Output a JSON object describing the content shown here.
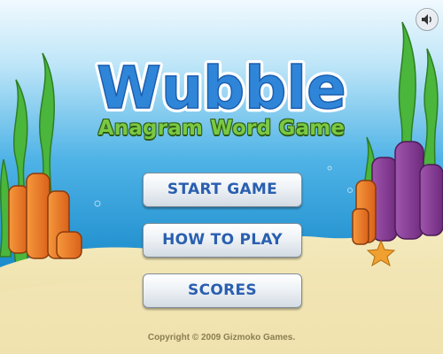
{
  "game": {
    "title": "Wubble",
    "subtitle": "Anagram Word Game",
    "copyright": "Copyright © 2009 Gizmoko Games."
  },
  "menu": {
    "items": [
      {
        "label": "START GAME",
        "name": "start-game-button"
      },
      {
        "label": "HOW TO PLAY",
        "name": "how-to-play-button"
      },
      {
        "label": "SCORES",
        "name": "scores-button"
      }
    ]
  },
  "controls": {
    "sound_icon": "speaker-icon"
  },
  "colors": {
    "water_top": "#e9f6fd",
    "water_bottom": "#0d7fc4",
    "sand": "#efe1ab",
    "title_fill": "#2f86d8",
    "subtitle": "#7ac943",
    "button_text": "#2a5fb0",
    "seaweed": "#4ab63c",
    "coral_orange": "#f07a28",
    "coral_purple": "#8b3e98",
    "starfish": "#f0a030"
  }
}
